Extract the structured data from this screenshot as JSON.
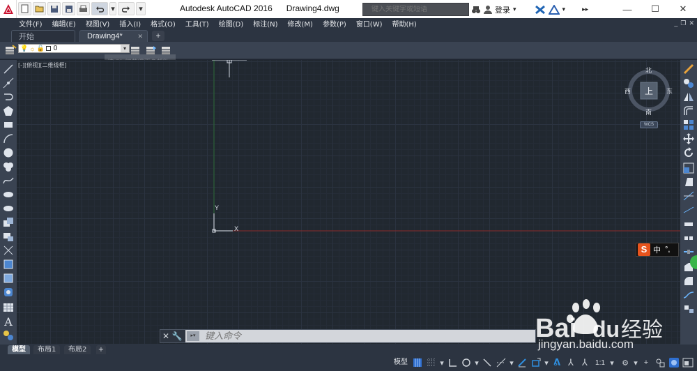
{
  "app": {
    "title": "Autodesk AutoCAD 2016",
    "document": "Drawing4.dwg"
  },
  "search": {
    "placeholder": "键入关键字或短语"
  },
  "account": {
    "signin_label": "登录"
  },
  "menu": [
    "文件(F)",
    "编辑(E)",
    "视图(V)",
    "插入(I)",
    "格式(O)",
    "工具(T)",
    "绘图(D)",
    "标注(N)",
    "修改(M)",
    "参数(P)",
    "窗口(W)",
    "帮助(H)"
  ],
  "tabs": [
    {
      "label": "开始"
    },
    {
      "label": "Drawing4*"
    }
  ],
  "layer": {
    "current": "0"
  },
  "tooltip": {
    "f1": "按 F1 键获得更多帮助"
  },
  "viewport": {
    "label": "[-][俯视][二维线框]"
  },
  "viewcube": {
    "north": "北",
    "south": "南",
    "east": "东",
    "west": "西",
    "face": "上",
    "wcs": "WCS"
  },
  "ucs": {
    "x": "X",
    "y": "Y"
  },
  "command": {
    "placeholder": "键入命令"
  },
  "layouts": [
    {
      "label": "模型"
    },
    {
      "label": "布局1"
    },
    {
      "label": "布局2"
    }
  ],
  "status": {
    "model": "模型",
    "scale": "1:1"
  },
  "ime": {
    "logo": "S",
    "mode": "中",
    "punct": "°,"
  },
  "watermark": {
    "brand_a": "Bai",
    "brand_b": "du",
    "brand_cn": "经验",
    "site": "jingyan.baidu.com"
  },
  "colors": {
    "canvas": "#212830",
    "ui_dark": "#3a4352",
    "x_axis": "#8b2a2a",
    "y_axis": "#2b6a35"
  }
}
